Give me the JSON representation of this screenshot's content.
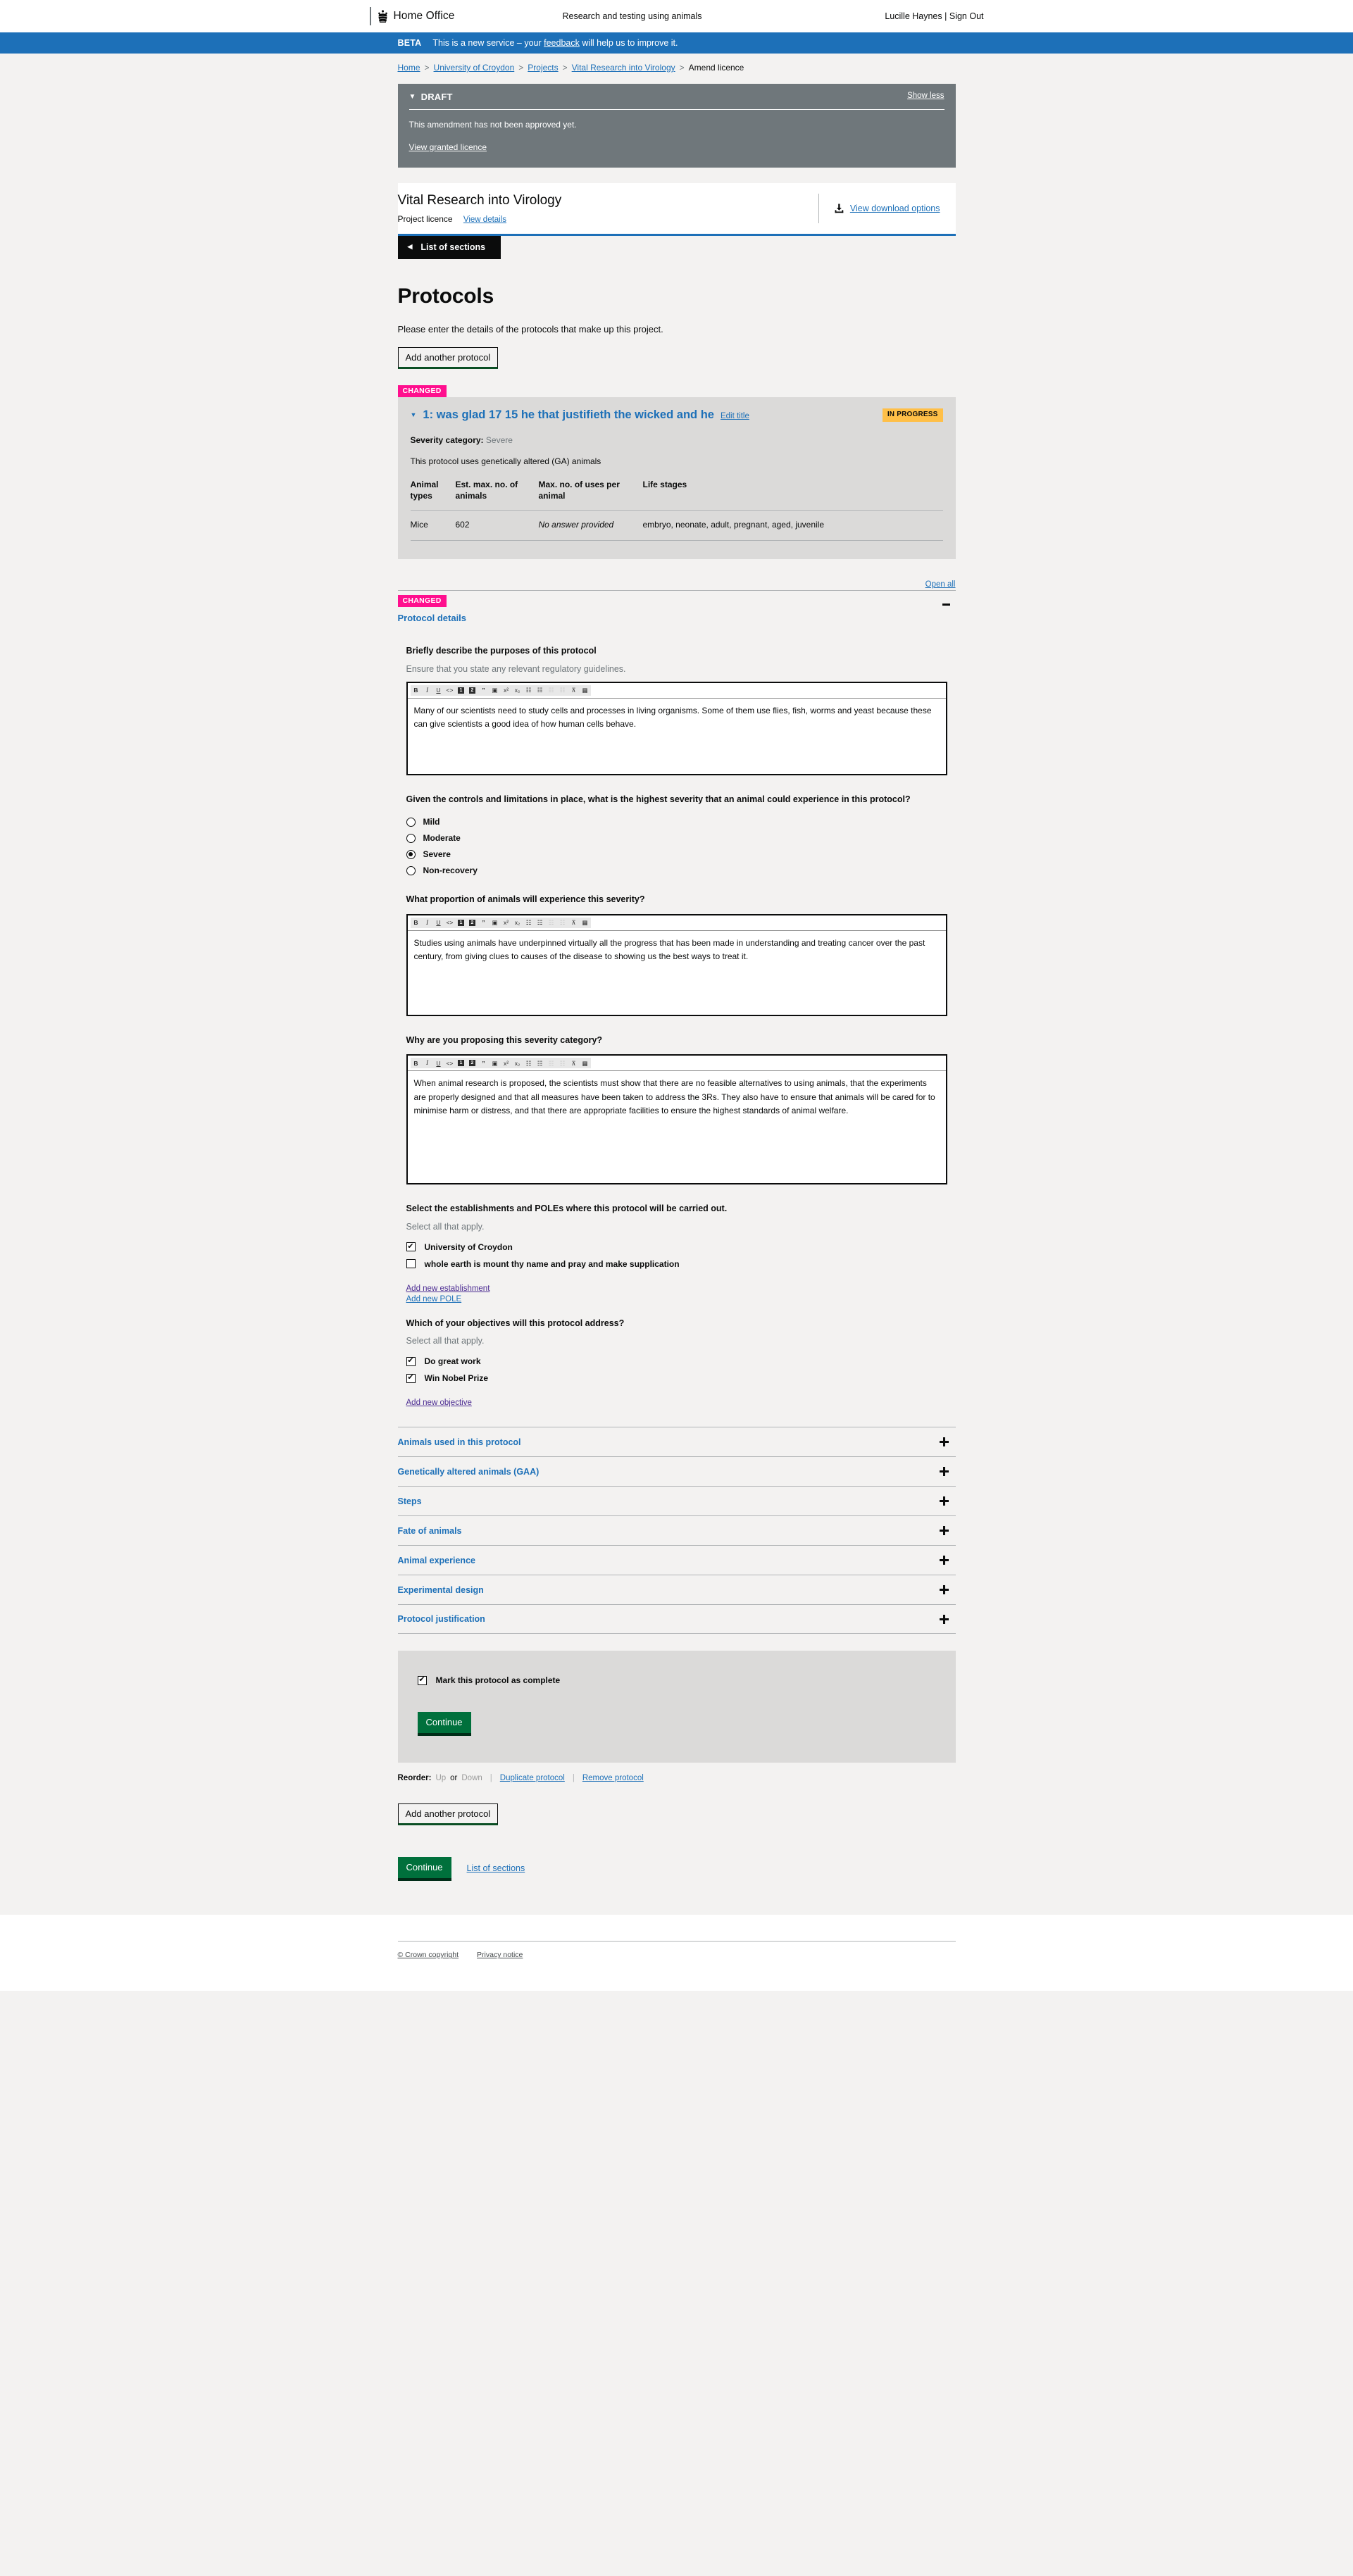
{
  "header": {
    "brand": "Home Office",
    "service_name": "Research and testing using animals",
    "user_name": "Lucille Haynes",
    "separator": "|",
    "sign_out": "Sign Out"
  },
  "beta_banner": {
    "tag": "BETA",
    "text_before": "This is a new service – your ",
    "link": "feedback",
    "text_after": " will help us to improve it."
  },
  "breadcrumbs": [
    {
      "label": "Home",
      "link": true
    },
    {
      "label": "University of Croydon",
      "link": true
    },
    {
      "label": "Projects",
      "link": true
    },
    {
      "label": "Vital Research into Virology",
      "link": true
    },
    {
      "label": "Amend licence",
      "link": false
    }
  ],
  "draft_banner": {
    "status": "DRAFT",
    "toggle": "Show less",
    "message": "This amendment has not been approved yet.",
    "link": "View granted licence"
  },
  "licence_header": {
    "title": "Vital Research into Virology",
    "type": "Project licence",
    "details_link": "View details",
    "download_link": "View download options"
  },
  "sections_button": "List of sections",
  "page": {
    "title": "Protocols",
    "intro": "Please enter the details of the protocols that make up this project.",
    "add_protocol_top": "Add another protocol",
    "add_protocol_bottom": "Add another protocol"
  },
  "protocol": {
    "changed_tag": "CHANGED",
    "number_and_title": "1: was glad 17 15 he that justifieth the wicked and he",
    "edit_title_link": "Edit title",
    "status_badge": "IN PROGRESS",
    "severity_label": "Severity category:",
    "severity_value": "Severe",
    "ga_line": "This protocol uses genetically altered (GA) animals",
    "table": {
      "headers": [
        "Animal types",
        "Est. max. no. of animals",
        "Max. no. of uses per animal",
        "Life stages"
      ],
      "rows": [
        {
          "animal_type": "Mice",
          "est_max_animals": "602",
          "max_uses": "No answer provided",
          "life_stages": "embryo, neonate, adult, pregnant, aged, juvenile"
        }
      ]
    },
    "open_all_link": "Open all",
    "details_section": {
      "changed_tag": "CHANGED",
      "title": "Protocol details"
    },
    "questions": {
      "purposes": {
        "label": "Briefly describe the purposes of this protocol",
        "hint": "Ensure that you state any relevant regulatory guidelines.",
        "value": "Many of our scientists need to study cells and processes in living organisms. Some of them use flies, fish, worms and yeast because these can give scientists a good idea of how human cells behave."
      },
      "severity": {
        "label": "Given the controls and limitations in place, what is the highest severity that an animal could experience in this protocol?",
        "options": [
          {
            "label": "Mild",
            "selected": false
          },
          {
            "label": "Moderate",
            "selected": false
          },
          {
            "label": "Severe",
            "selected": true
          },
          {
            "label": "Non-recovery",
            "selected": false
          }
        ]
      },
      "proportion": {
        "label": "What proportion of animals will experience this severity?",
        "value": "Studies using animals have underpinned virtually all the progress that has been made in understanding and treating cancer over the past century, from giving clues to causes of the disease to showing us the best ways to treat it."
      },
      "why_severity": {
        "label": "Why are you proposing this severity category?",
        "value": "When animal research is proposed, the scientists must show that there are no feasible alternatives to using animals, that the experiments are properly designed and that all measures have been taken to address the 3Rs. They also have to ensure that animals will be cared for to minimise harm or distress, and that there are appropriate facilities to ensure the highest standards of animal welfare."
      },
      "establishments": {
        "label": "Select the establishments and POLEs where this protocol will be carried out.",
        "hint": "Select all that apply.",
        "options": [
          {
            "label": "University of Croydon",
            "checked": true
          },
          {
            "label": "whole earth is mount thy name and pray and make supplication",
            "checked": false
          }
        ],
        "add_establishment_link": "Add new establishment",
        "add_pole_link": "Add new POLE"
      },
      "objectives": {
        "label": "Which of your objectives will this protocol address?",
        "hint": "Select all that apply.",
        "options": [
          {
            "label": "Do great work",
            "checked": true
          },
          {
            "label": "Win Nobel Prize",
            "checked": true
          }
        ],
        "add_objective_link": "Add new objective"
      }
    },
    "collapsed_sections": [
      "Animals used in this protocol",
      "Genetically altered animals (GAA)",
      "Steps",
      "Fate of animals",
      "Animal experience",
      "Experimental design",
      "Protocol justification"
    ],
    "complete": {
      "checkbox_label": "Mark this protocol as complete",
      "checked": true,
      "continue_button": "Continue"
    },
    "reorder": {
      "label": "Reorder:",
      "up": "Up",
      "or": "or",
      "down": "Down",
      "duplicate": "Duplicate protocol",
      "remove": "Remove protocol"
    }
  },
  "footer_actions": {
    "continue_button": "Continue",
    "list_of_sections_link": "List of sections"
  },
  "site_footer": {
    "crown_copyright": "© Crown copyright",
    "privacy_notice": "Privacy notice"
  },
  "editor_toolbar": {
    "buttons": [
      {
        "name": "bold-icon",
        "glyph": "B",
        "disabled": false
      },
      {
        "name": "italic-icon",
        "glyph": "I",
        "disabled": false
      },
      {
        "name": "underline-icon",
        "glyph": "U",
        "disabled": false
      },
      {
        "name": "code-icon",
        "glyph": "<>",
        "disabled": false
      },
      {
        "name": "heading-1-icon",
        "glyph": "1",
        "disabled": false
      },
      {
        "name": "heading-2-icon",
        "glyph": "2",
        "disabled": false
      },
      {
        "name": "blockquote-icon",
        "glyph": "\"",
        "disabled": false
      },
      {
        "name": "image-icon",
        "glyph": "▣",
        "disabled": false
      },
      {
        "name": "superscript-icon",
        "glyph": "x²",
        "disabled": false
      },
      {
        "name": "subscript-icon",
        "glyph": "x₂",
        "disabled": false
      },
      {
        "name": "bullet-list-icon",
        "glyph": "☰",
        "disabled": false
      },
      {
        "name": "numbered-list-icon",
        "glyph": "☰",
        "disabled": false
      },
      {
        "name": "outdent-icon",
        "glyph": "☰",
        "disabled": true
      },
      {
        "name": "indent-icon",
        "glyph": "☰",
        "disabled": true
      },
      {
        "name": "clear-formatting-icon",
        "glyph": "T̶",
        "disabled": false
      },
      {
        "name": "table-icon",
        "glyph": "▦",
        "disabled": false
      }
    ]
  },
  "colors": {
    "accent_blue": "#1d70b8",
    "changed_pink": "#ff0f8e",
    "in_progress_amber": "#ffbf47",
    "green_button": "#00703c",
    "draft_grey": "#6f777b"
  }
}
